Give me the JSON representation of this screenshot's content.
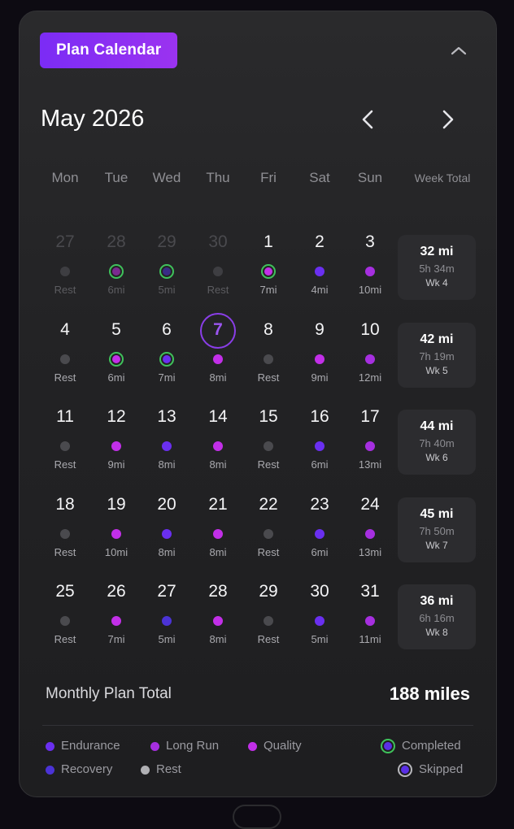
{
  "header": {
    "badge": "Plan Calendar"
  },
  "calendar": {
    "month_title": "May 2026",
    "days_of_week": [
      "Mon",
      "Tue",
      "Wed",
      "Thu",
      "Fri",
      "Sat",
      "Sun"
    ],
    "week_total_header": "Week Total",
    "weeks": [
      {
        "days": [
          {
            "day": "27",
            "type": "rest",
            "label": "Rest",
            "out": true
          },
          {
            "day": "28",
            "type": "quality",
            "label": "6mi",
            "out": true,
            "completed": true
          },
          {
            "day": "29",
            "type": "recovery",
            "label": "5mi",
            "out": true,
            "completed": true
          },
          {
            "day": "30",
            "type": "rest",
            "label": "Rest",
            "out": true
          },
          {
            "day": "1",
            "type": "quality",
            "label": "7mi",
            "completed": true
          },
          {
            "day": "2",
            "type": "endurance",
            "label": "4mi"
          },
          {
            "day": "3",
            "type": "longrun",
            "label": "10mi"
          }
        ],
        "total": {
          "miles": "32 mi",
          "time": "5h 34m",
          "week": "Wk 4"
        }
      },
      {
        "days": [
          {
            "day": "4",
            "type": "rest",
            "label": "Rest"
          },
          {
            "day": "5",
            "type": "quality",
            "label": "6mi",
            "completed": true
          },
          {
            "day": "6",
            "type": "endurance",
            "label": "7mi",
            "completed": true
          },
          {
            "day": "7",
            "type": "quality",
            "label": "8mi",
            "today": true
          },
          {
            "day": "8",
            "type": "rest",
            "label": "Rest"
          },
          {
            "day": "9",
            "type": "quality",
            "label": "9mi"
          },
          {
            "day": "10",
            "type": "longrun",
            "label": "12mi"
          }
        ],
        "total": {
          "miles": "42 mi",
          "time": "7h 19m",
          "week": "Wk 5"
        }
      },
      {
        "days": [
          {
            "day": "11",
            "type": "rest",
            "label": "Rest"
          },
          {
            "day": "12",
            "type": "quality",
            "label": "9mi"
          },
          {
            "day": "13",
            "type": "endurance",
            "label": "8mi"
          },
          {
            "day": "14",
            "type": "quality",
            "label": "8mi"
          },
          {
            "day": "15",
            "type": "rest",
            "label": "Rest"
          },
          {
            "day": "16",
            "type": "endurance",
            "label": "6mi"
          },
          {
            "day": "17",
            "type": "longrun",
            "label": "13mi"
          }
        ],
        "total": {
          "miles": "44 mi",
          "time": "7h 40m",
          "week": "Wk 6"
        }
      },
      {
        "days": [
          {
            "day": "18",
            "type": "rest",
            "label": "Rest"
          },
          {
            "day": "19",
            "type": "quality",
            "label": "10mi"
          },
          {
            "day": "20",
            "type": "endurance",
            "label": "8mi"
          },
          {
            "day": "21",
            "type": "quality",
            "label": "8mi"
          },
          {
            "day": "22",
            "type": "rest",
            "label": "Rest"
          },
          {
            "day": "23",
            "type": "endurance",
            "label": "6mi"
          },
          {
            "day": "24",
            "type": "longrun",
            "label": "13mi"
          }
        ],
        "total": {
          "miles": "45 mi",
          "time": "7h 50m",
          "week": "Wk 7"
        }
      },
      {
        "days": [
          {
            "day": "25",
            "type": "rest",
            "label": "Rest"
          },
          {
            "day": "26",
            "type": "quality",
            "label": "7mi"
          },
          {
            "day": "27",
            "type": "recovery",
            "label": "5mi"
          },
          {
            "day": "28",
            "type": "quality",
            "label": "8mi"
          },
          {
            "day": "29",
            "type": "rest",
            "label": "Rest"
          },
          {
            "day": "30",
            "type": "endurance",
            "label": "5mi"
          },
          {
            "day": "31",
            "type": "longrun",
            "label": "11mi"
          }
        ],
        "total": {
          "miles": "36 mi",
          "time": "6h 16m",
          "week": "Wk 8"
        }
      }
    ]
  },
  "summary": {
    "label": "Monthly Plan Total",
    "value": "188 miles"
  },
  "legend": {
    "endurance": "Endurance",
    "longrun": "Long Run",
    "quality": "Quality",
    "completed": "Completed",
    "recovery": "Recovery",
    "rest": "Rest",
    "skipped": "Skipped"
  },
  "icons": {
    "collapse": "chevron-up-icon",
    "prev": "chevron-left-icon",
    "next": "chevron-right-icon"
  },
  "colors": {
    "endurance": "#6a2ff0",
    "longrun": "#a62fe0",
    "quality": "#c22fe8",
    "recovery": "#4b33d6",
    "rest": "#4a4a4e",
    "out_rest": "#3e3e42",
    "completed_ring": "#3fc25b",
    "skipped_ring": "#b8b8bd",
    "accent": "#8a3ee8"
  }
}
